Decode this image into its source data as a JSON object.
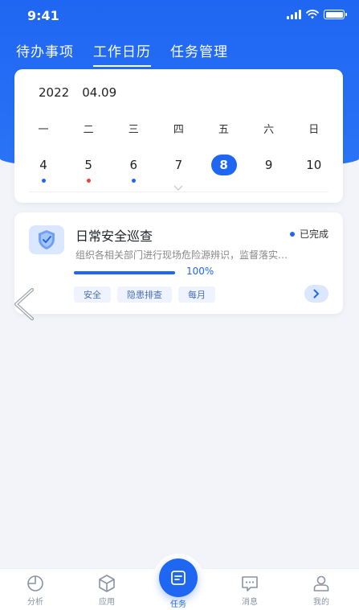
{
  "status_bar": {
    "time": "9:41"
  },
  "tabs": [
    {
      "label": "待办事项",
      "active": false
    },
    {
      "label": "工作日历",
      "active": true
    },
    {
      "label": "任务管理",
      "active": false
    }
  ],
  "calendar": {
    "year": "2022",
    "date": "04.09",
    "weekdays": [
      "一",
      "二",
      "三",
      "四",
      "五",
      "六",
      "日"
    ],
    "days": [
      {
        "num": "4",
        "dot": "#1f66f2"
      },
      {
        "num": "5",
        "dot": "#e8453c"
      },
      {
        "num": "6",
        "dot": "#1f66f2"
      },
      {
        "num": "7",
        "dot": null
      },
      {
        "num": "8",
        "dot": null,
        "selected": true
      },
      {
        "num": "9",
        "dot": null
      },
      {
        "num": "10",
        "dot": null
      }
    ]
  },
  "task": {
    "title": "日常安全巡查",
    "status": "已完成",
    "description": "组织各相关部门进行现场危险源辨识，监督落实…",
    "progress": 1.0,
    "progress_label": "100%",
    "tags": [
      "安全",
      "隐患排查",
      "每月"
    ]
  },
  "bottom_nav": {
    "items": [
      {
        "label": "分析",
        "icon": "chart-pie-icon"
      },
      {
        "label": "应用",
        "icon": "cube-icon"
      },
      {
        "label": "任务",
        "icon": "task-icon",
        "active": true
      },
      {
        "label": "消息",
        "icon": "message-icon"
      },
      {
        "label": "我的",
        "icon": "user-icon"
      }
    ]
  },
  "colors": {
    "primary": "#1f66f2",
    "danger": "#e8453c",
    "background": "#f2f4f9"
  }
}
